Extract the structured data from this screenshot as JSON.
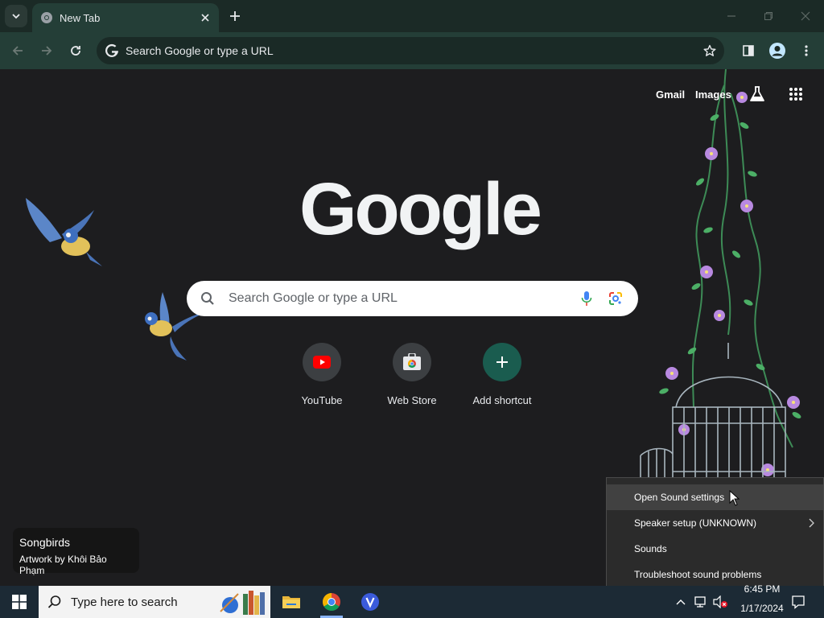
{
  "browser": {
    "tab": {
      "title": "New Tab"
    },
    "omnibox": {
      "text": "Search Google or type a URL"
    }
  },
  "ntp": {
    "top_links": {
      "gmail": "Gmail",
      "images": "Images"
    },
    "logo": "Google",
    "search": {
      "placeholder": "Search Google or type a URL"
    },
    "shortcuts": [
      {
        "label": "YouTube",
        "icon": "youtube-icon"
      },
      {
        "label": "Web Store",
        "icon": "web-store-icon"
      },
      {
        "label": "Add shortcut",
        "icon": "plus-icon"
      }
    ],
    "attribution": {
      "title": "Songbirds",
      "artist": "Artwork by Khôi Bảo Phạm"
    }
  },
  "context_menu": {
    "items": [
      {
        "label": "Open Sound settings",
        "highlighted": true
      },
      {
        "label": "Speaker setup (UNKNOWN)",
        "submenu": true
      },
      {
        "label": "Sounds"
      },
      {
        "label": "Troubleshoot sound problems"
      }
    ]
  },
  "taskbar": {
    "search_placeholder": "Type here to search",
    "apps": [
      "file-explorer-icon",
      "chrome-icon",
      "v-app-icon"
    ],
    "clock": {
      "time": "6:45 PM",
      "date": "1/17/2024"
    }
  },
  "colors": {
    "tabstrip": "#1b2a26",
    "toolbar": "#243e37",
    "ntp_background": "#1d1d1f",
    "add_shortcut": "#1a5c4f",
    "taskbar": "#1c2a35"
  }
}
